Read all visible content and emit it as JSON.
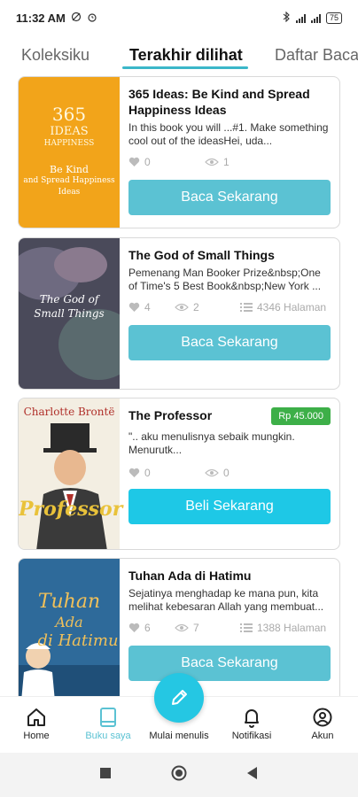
{
  "status_bar": {
    "time": "11:32 AM",
    "battery": "75"
  },
  "tabs": [
    {
      "label": "Koleksiku",
      "active": false
    },
    {
      "label": "Terakhir dilihat",
      "active": true
    },
    {
      "label": "Daftar Baca",
      "active": false
    }
  ],
  "books": [
    {
      "title": "365 Ideas: Be Kind and Spread Happiness Ideas",
      "description": "In this book you will ...#1. Make something cool out of the ideasHei, uda...",
      "likes": "0",
      "views": "1",
      "pages": "",
      "price": "",
      "button": "Baca Sekarang",
      "cover": {
        "bg": "#f2a41a",
        "line1": "365",
        "line2": "IDEAS",
        "line3": "HAPPINESS",
        "line4": "Be Kind",
        "line5": "and Spread Happiness",
        "line6": "Ideas"
      }
    },
    {
      "title": "The God of Small Things",
      "description": "Pemenang Man Booker Prize&nbsp;One of Time's 5 Best Book&nbsp;New York ...",
      "likes": "4",
      "views": "2",
      "pages": "4346 Halaman",
      "price": "",
      "button": "Baca Sekarang",
      "cover": {
        "bg": "#4a4a5a",
        "line1": "The God of",
        "line2": "Small Things"
      }
    },
    {
      "title": "The Professor",
      "description": "\".. aku menulisnya sebaik mungkin. Menurutk...",
      "likes": "0",
      "views": "0",
      "pages": "",
      "price": "Rp 45.000",
      "button": "Beli Sekarang",
      "cover": {
        "bg": "#f3eee2",
        "author": "Charlotte Brontë",
        "line1": "Professor"
      }
    },
    {
      "title": "Tuhan Ada di Hatimu",
      "description": "Sejatinya menghadap ke mana pun, kita melihat kebesaran Allah yang membuat...",
      "likes": "6",
      "views": "7",
      "pages": "1388 Halaman",
      "price": "",
      "button": "Baca Sekarang",
      "cover": {
        "bg": "#2e6a9a",
        "line1": "Tuhan",
        "line2": "Ada",
        "line3": "di Hatimu"
      }
    }
  ],
  "bottom_nav": [
    {
      "label": "Home",
      "icon": "home-icon",
      "active": false
    },
    {
      "label": "Buku saya",
      "icon": "book-icon",
      "active": true
    },
    {
      "label": "Mulai menulis",
      "icon": "pencil-icon",
      "active": false
    },
    {
      "label": "Notifikasi",
      "icon": "bell-icon",
      "active": false
    },
    {
      "label": "Akun",
      "icon": "account-icon",
      "active": false
    }
  ],
  "colors": {
    "accent": "#5bc2d3",
    "fab": "#25c7e3",
    "price_badge": "#3daf48"
  }
}
